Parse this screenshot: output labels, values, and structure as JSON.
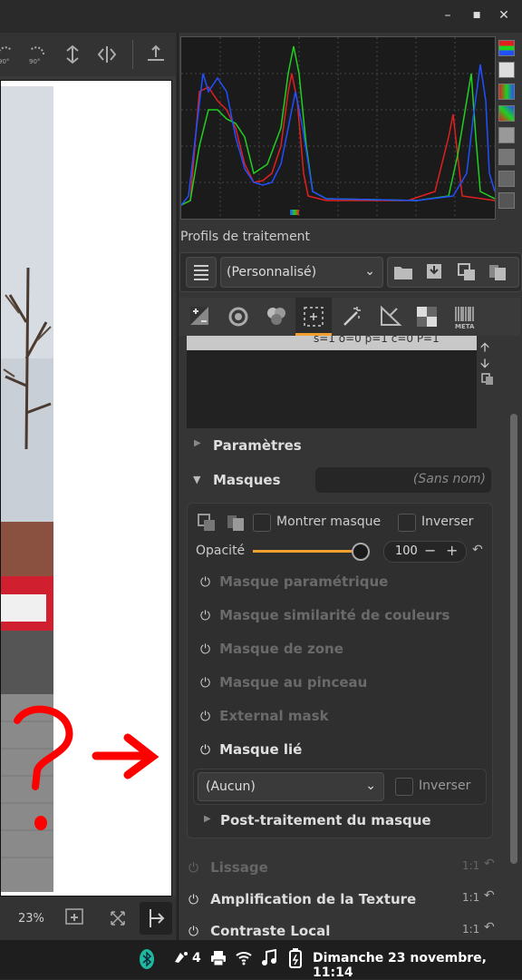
{
  "window": {
    "minimize": "–",
    "maximize": "■",
    "close": "✕"
  },
  "toolbar": {
    "rotate_left_label": "90°",
    "rotate_right_label": "90°"
  },
  "bottom_toolbar": {
    "zoom": "23%"
  },
  "profiles": {
    "title": "Profils de traitement",
    "selected": "(Personnalisé)"
  },
  "tool_tabs": [
    "exposure-tab",
    "detail-tab",
    "color-tab",
    "local-adjustments-tab",
    "transform-tab",
    "raw-tab",
    "advanced-tab",
    "metadata-tab"
  ],
  "local_adj": {
    "spot_list_row": "s=1 o=0 p=1 c=0 P=1",
    "parametres": "Paramètres",
    "masques": "Masques",
    "mask_name_placeholder": "(Sans nom)",
    "show_mask": "Montrer masque",
    "invert": "Inverser",
    "opacity_label": "Opacité",
    "opacity_value": "100",
    "opacity_fraction": 1.0,
    "mask_items": [
      {
        "label": "Masque paramétrique",
        "active": false
      },
      {
        "label": "Masque similarité de couleurs",
        "active": false
      },
      {
        "label": "Masque de zone",
        "active": false
      },
      {
        "label": "Masque au pinceau",
        "active": false
      },
      {
        "label": "External mask",
        "active": false
      },
      {
        "label": "Masque lié",
        "active": true
      }
    ],
    "linked_mask_value": "(Aucun)",
    "linked_invert": "Inverser",
    "post_processing": "Post-traitement du masque"
  },
  "modules": [
    {
      "label": "Lissage",
      "scale": "1:1",
      "enabled": false
    },
    {
      "label": "Amplification de la Texture",
      "scale": "1:1",
      "enabled": true
    },
    {
      "label": "Contraste Local",
      "scale": "1:1",
      "enabled": true
    }
  ],
  "taskbar": {
    "notif_count": "4",
    "datetime": "Dimanche 23 novembre, 11:14"
  },
  "colors": {
    "accent": "#f0a030",
    "histo_red": "#e02020",
    "histo_green": "#20d020",
    "histo_blue": "#2050ff",
    "annotation_red": "#ff0000"
  }
}
